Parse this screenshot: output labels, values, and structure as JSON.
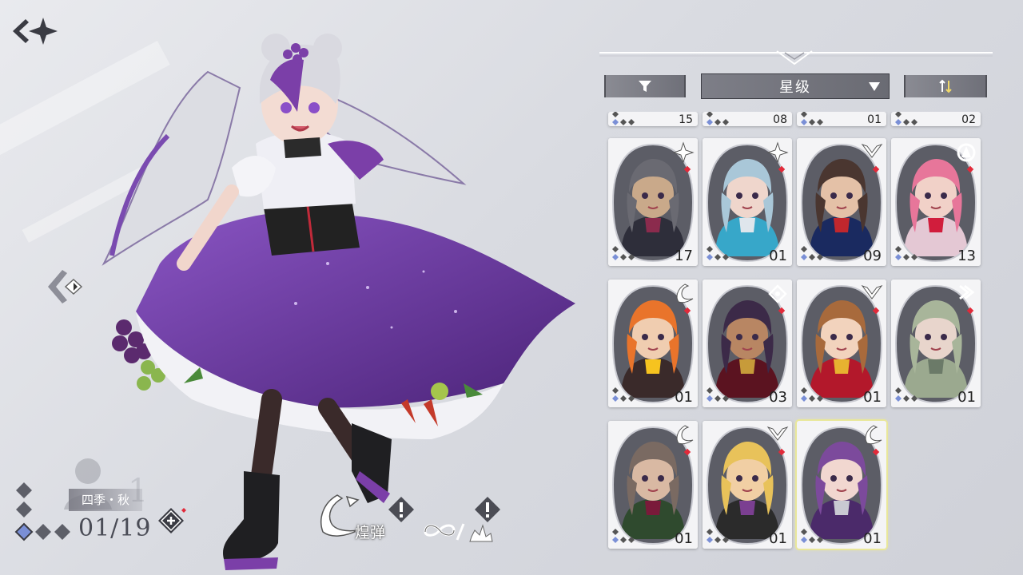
{
  "screen": {
    "character": {
      "name": "四季・秋",
      "count": "01/19"
    },
    "skill": {
      "name": "煌弹"
    },
    "sort": {
      "label": "星级"
    },
    "top_row_levels": [
      "15",
      "08",
      "01",
      "02"
    ],
    "cards": [
      {
        "level": "17",
        "icon": "star-burst-icon",
        "skin": "#c9a98a",
        "hair": "#6a6a72",
        "outfit": "#2e2e3a",
        "accent": "#8b2b4d"
      },
      {
        "level": "01",
        "icon": "star-burst-icon",
        "skin": "#efd6cc",
        "hair": "#a9c7d8",
        "outfit": "#37a7c9",
        "accent": "#dfe6ec"
      },
      {
        "level": "09",
        "icon": "wings-icon",
        "skin": "#e4c1a7",
        "hair": "#4a3630",
        "outfit": "#1a2a60",
        "accent": "#c1272d"
      },
      {
        "level": "13",
        "icon": "spade-ring-icon",
        "skin": "#f1d1c8",
        "hair": "#e7769a",
        "outfit": "#e4c8d4",
        "accent": "#d11d3c"
      },
      {
        "level": "01",
        "icon": "swoosh-icon",
        "skin": "#f0cdb0",
        "hair": "#e9742b",
        "outfit": "#3a2a2a",
        "accent": "#f6c31f"
      },
      {
        "level": "03",
        "icon": "eye-diamond-icon",
        "skin": "#b88663",
        "hair": "#3c2a48",
        "outfit": "#5b1320",
        "accent": "#c79b3a"
      },
      {
        "level": "01",
        "icon": "wings-icon",
        "skin": "#f2d3bd",
        "hair": "#a86a3c",
        "outfit": "#b3182b",
        "accent": "#e7b230"
      },
      {
        "level": "01",
        "icon": "triple-chevron-icon",
        "skin": "#e8d5cc",
        "hair": "#a8b59a",
        "outfit": "#9ba98f",
        "accent": "#6b7a68"
      },
      {
        "level": "01",
        "icon": "swoosh-icon",
        "skin": "#d9b9a3",
        "hair": "#7a6a62",
        "outfit": "#2f4a2e",
        "accent": "#7a1a3a"
      },
      {
        "level": "01",
        "icon": "wings-icon",
        "skin": "#f1cfa4",
        "hair": "#e8c25a",
        "outfit": "#2b2b2b",
        "accent": "#7b3f91"
      },
      {
        "level": "01",
        "icon": "swoosh-icon",
        "skin": "#f1d7d0",
        "hair": "#7c4a9c",
        "outfit": "#4b2a6a",
        "accent": "#c9c9d2",
        "selected": true
      }
    ],
    "colors": {
      "bg": "#dcdde2",
      "panel_grey": "#767780",
      "purple": "#7b3fa8",
      "selected_glow": "#e9e79a",
      "rarity_blue": "#7a8fd6"
    }
  }
}
